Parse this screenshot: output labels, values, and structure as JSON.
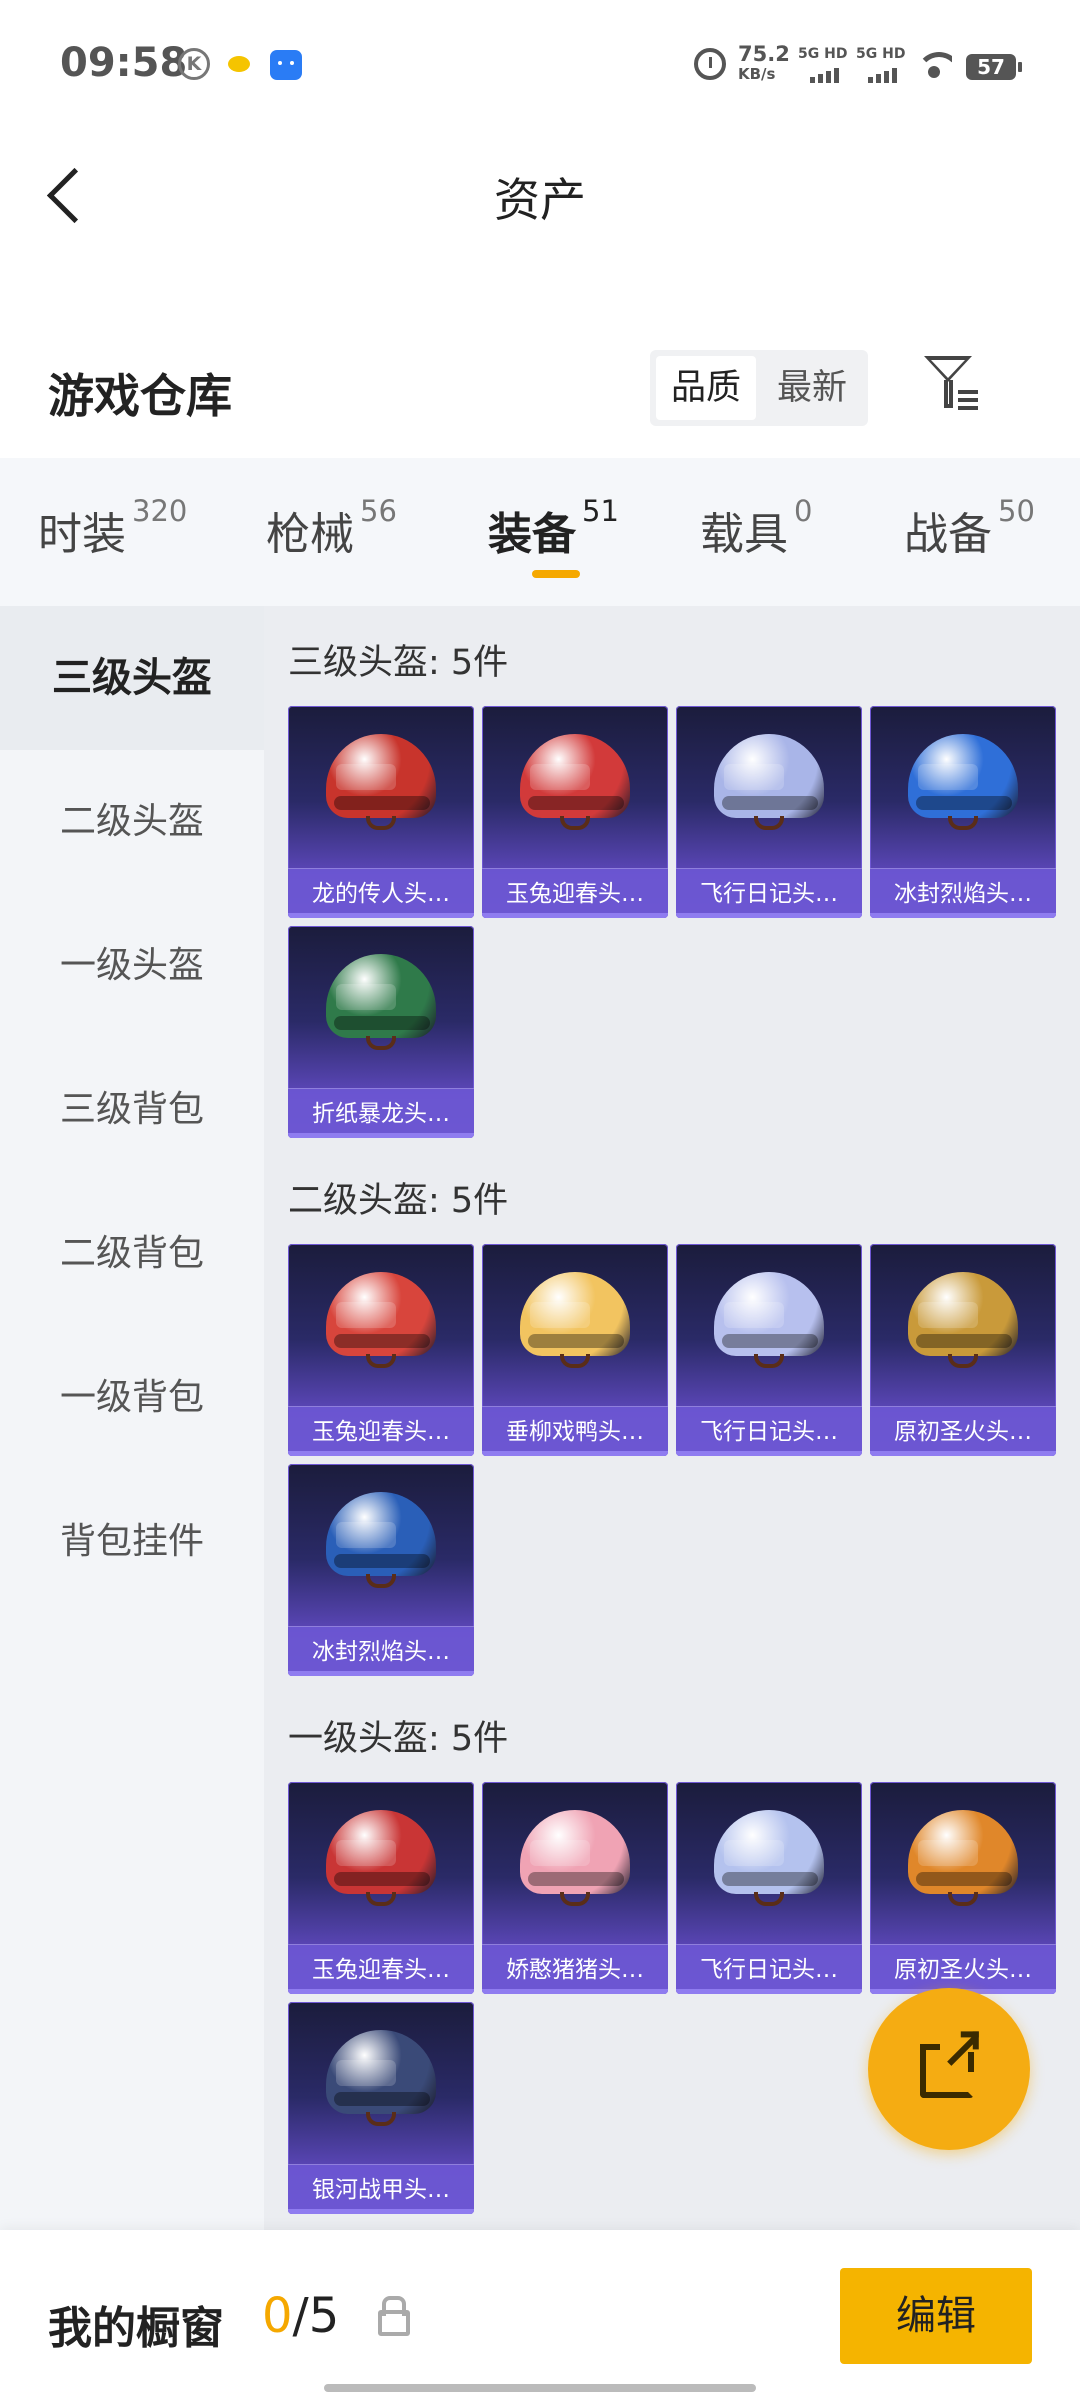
{
  "status_bar": {
    "time": "09:58",
    "net_speed": "75.2",
    "net_unit": "KB/s",
    "sig1": "5G HD",
    "sig2": "5G HD",
    "battery": "57"
  },
  "header": {
    "title": "资产"
  },
  "section": {
    "title": "游戏仓库",
    "sort_quality": "品质",
    "sort_newest": "最新"
  },
  "tabs": [
    {
      "label": "时装",
      "count": "320"
    },
    {
      "label": "枪械",
      "count": "56"
    },
    {
      "label": "装备",
      "count": "51"
    },
    {
      "label": "载具",
      "count": "0"
    },
    {
      "label": "战备",
      "count": "50"
    }
  ],
  "sidebar": [
    "三级头盔",
    "二级头盔",
    "一级头盔",
    "三级背包",
    "二级背包",
    "一级背包",
    "背包挂件"
  ],
  "groups": [
    {
      "title": "三级头盔: 5件",
      "items": [
        {
          "name": "龙的传人头…",
          "icon": "red-helmet-icon",
          "color": "#c8342c"
        },
        {
          "name": "玉兔迎春头…",
          "icon": "red-white-helmet-icon",
          "color": "#d23a3a"
        },
        {
          "name": "飞行日记头…",
          "icon": "blue-pink-helmet-icon",
          "color": "#a9b5e8"
        },
        {
          "name": "冰封烈焰头…",
          "icon": "fire-ice-helmet-icon",
          "color": "#2f6fd8"
        },
        {
          "name": "折纸暴龙头…",
          "icon": "dragon-helmet-icon",
          "color": "#2f7a4a"
        }
      ]
    },
    {
      "title": "二级头盔: 5件",
      "items": [
        {
          "name": "玉兔迎春头…",
          "icon": "red-white-helmet-icon",
          "color": "#d8453c"
        },
        {
          "name": "垂柳戏鸭头…",
          "icon": "yellow-helmet-icon",
          "color": "#f2c460"
        },
        {
          "name": "飞行日记头…",
          "icon": "lilac-helmet-icon",
          "color": "#b7c0ee"
        },
        {
          "name": "原初圣火头…",
          "icon": "gold-helmet-icon",
          "color": "#c99a3a"
        },
        {
          "name": "冰封烈焰头…",
          "icon": "blue-helmet-icon",
          "color": "#2a5fb8"
        }
      ]
    },
    {
      "title": "一级头盔: 5件",
      "items": [
        {
          "name": "玉兔迎春头…",
          "icon": "red-white-helmet-icon",
          "color": "#c93535"
        },
        {
          "name": "娇憨猪猪头…",
          "icon": "pig-helmet-icon",
          "color": "#f0a3b4"
        },
        {
          "name": "飞行日记头…",
          "icon": "lilac-helmet-icon",
          "color": "#b4c2ee"
        },
        {
          "name": "原初圣火头…",
          "icon": "orange-helmet-icon",
          "color": "#e0872a"
        },
        {
          "name": "银河战甲头…",
          "icon": "galaxy-helmet-icon",
          "color": "#3a4a78"
        }
      ]
    }
  ],
  "bottom": {
    "title": "我的橱窗",
    "count_used": "0",
    "count_total": "/5",
    "edit": "编辑"
  },
  "colors": {
    "accent": "#f5a800",
    "card_bg": "#2a2a67",
    "card_caption": "#6c56d2"
  }
}
